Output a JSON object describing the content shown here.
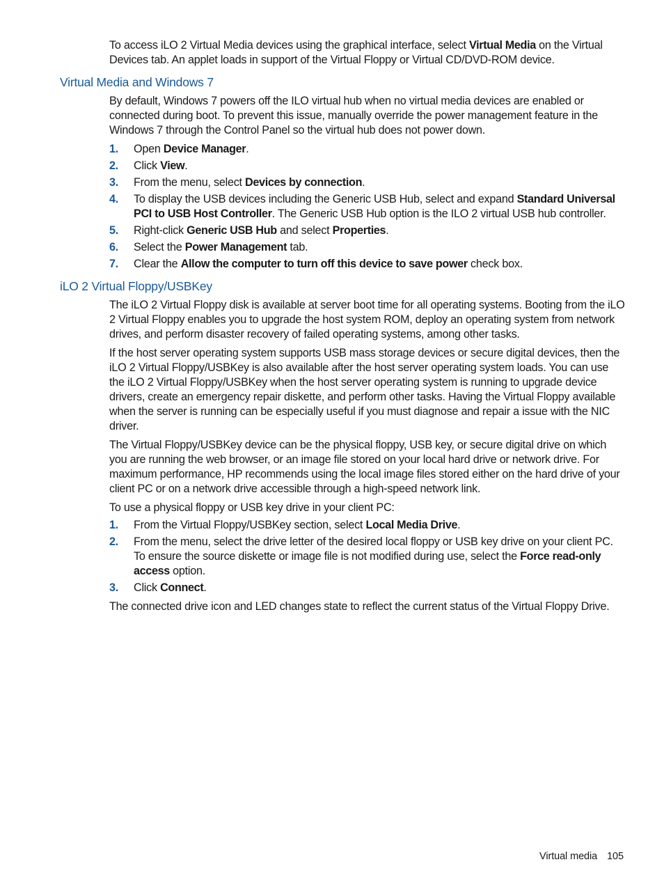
{
  "intro": {
    "parts": [
      {
        "t": "To access iLO 2 Virtual Media devices using the graphical interface, select "
      },
      {
        "b": "Virtual Media"
      },
      {
        "t": " on the Virtual Devices tab. An applet loads in support of the Virtual Floppy or Virtual CD/DVD-ROM device."
      }
    ]
  },
  "sections": [
    {
      "heading": "Virtual Media and Windows 7",
      "paragraph": "By default, Windows 7 powers off the ILO virtual hub when no virtual media devices are enabled or connected during boot. To prevent this issue, manually override the power management feature in the Windows 7 through the Control Panel so the virtual hub does not power down.",
      "steps": [
        {
          "num": "1.",
          "parts": [
            {
              "t": "Open "
            },
            {
              "b": "Device Manager"
            },
            {
              "t": "."
            }
          ]
        },
        {
          "num": "2.",
          "parts": [
            {
              "t": "Click "
            },
            {
              "b": "View"
            },
            {
              "t": "."
            }
          ]
        },
        {
          "num": "3.",
          "parts": [
            {
              "t": "From the menu, select "
            },
            {
              "b": "Devices by connection"
            },
            {
              "t": "."
            }
          ]
        },
        {
          "num": "4.",
          "parts": [
            {
              "t": "To display the USB devices including the Generic USB Hub, select and expand "
            },
            {
              "b": "Standard Universal PCI to USB Host Controller"
            },
            {
              "t": ". The Generic USB Hub option is the ILO 2 virtual USB hub controller."
            }
          ]
        },
        {
          "num": "5.",
          "parts": [
            {
              "t": "Right-click "
            },
            {
              "b": "Generic USB Hub"
            },
            {
              "t": " and select "
            },
            {
              "b": "Properties"
            },
            {
              "t": "."
            }
          ]
        },
        {
          "num": "6.",
          "parts": [
            {
              "t": "Select the "
            },
            {
              "b": "Power Management"
            },
            {
              "t": " tab."
            }
          ]
        },
        {
          "num": "7.",
          "parts": [
            {
              "t": "Clear the "
            },
            {
              "b": "Allow the computer to turn off this device to save power"
            },
            {
              "t": " check box."
            }
          ]
        }
      ]
    },
    {
      "heading": "iLO 2 Virtual Floppy/USBKey",
      "paragraphs": [
        "The iLO 2 Virtual Floppy disk is available at server boot time for all operating systems. Booting from the iLO 2 Virtual Floppy enables you to upgrade the host system ROM, deploy an operating system from network drives, and perform disaster recovery of failed operating systems, among other tasks.",
        "If the host server operating system supports USB mass storage devices or secure digital devices, then the iLO 2 Virtual Floppy/USBKey is also available after the host server operating system loads. You can use the iLO 2 Virtual Floppy/USBKey when the host server operating system is running to upgrade device drivers, create an emergency repair diskette, and perform other tasks. Having the Virtual Floppy available when the server is running can be especially useful if you must diagnose and repair a issue with the NIC driver.",
        "The Virtual Floppy/USBKey device can be the physical floppy, USB key, or secure digital drive on which you are running the web browser, or an image file stored on your local hard drive or network drive. For maximum performance, HP recommends using the local image files stored either on the hard drive of your client PC or on a network drive accessible through a high-speed network link.",
        "To use a physical floppy or USB key drive in your client PC:"
      ],
      "steps": [
        {
          "num": "1.",
          "parts": [
            {
              "t": "From the Virtual Floppy/USBKey section, select "
            },
            {
              "b": "Local Media Drive"
            },
            {
              "t": "."
            }
          ]
        },
        {
          "num": "2.",
          "parts": [
            {
              "t": "From the menu, select the drive letter of the desired local floppy or USB key drive on your client PC. To ensure the source diskette or image file is not modified during use, select the "
            },
            {
              "b": "Force read-only access"
            },
            {
              "t": " option."
            }
          ]
        },
        {
          "num": "3.",
          "parts": [
            {
              "t": "Click "
            },
            {
              "b": "Connect"
            },
            {
              "t": "."
            }
          ]
        }
      ],
      "closing": "The connected drive icon and LED changes state to reflect the current status of the Virtual Floppy Drive."
    }
  ],
  "footer": {
    "section": "Virtual media",
    "page_number": "105"
  },
  "colors": {
    "heading": "#1a5a9a",
    "step_number": "#1a5a9a",
    "text": "#1a1a1a"
  }
}
